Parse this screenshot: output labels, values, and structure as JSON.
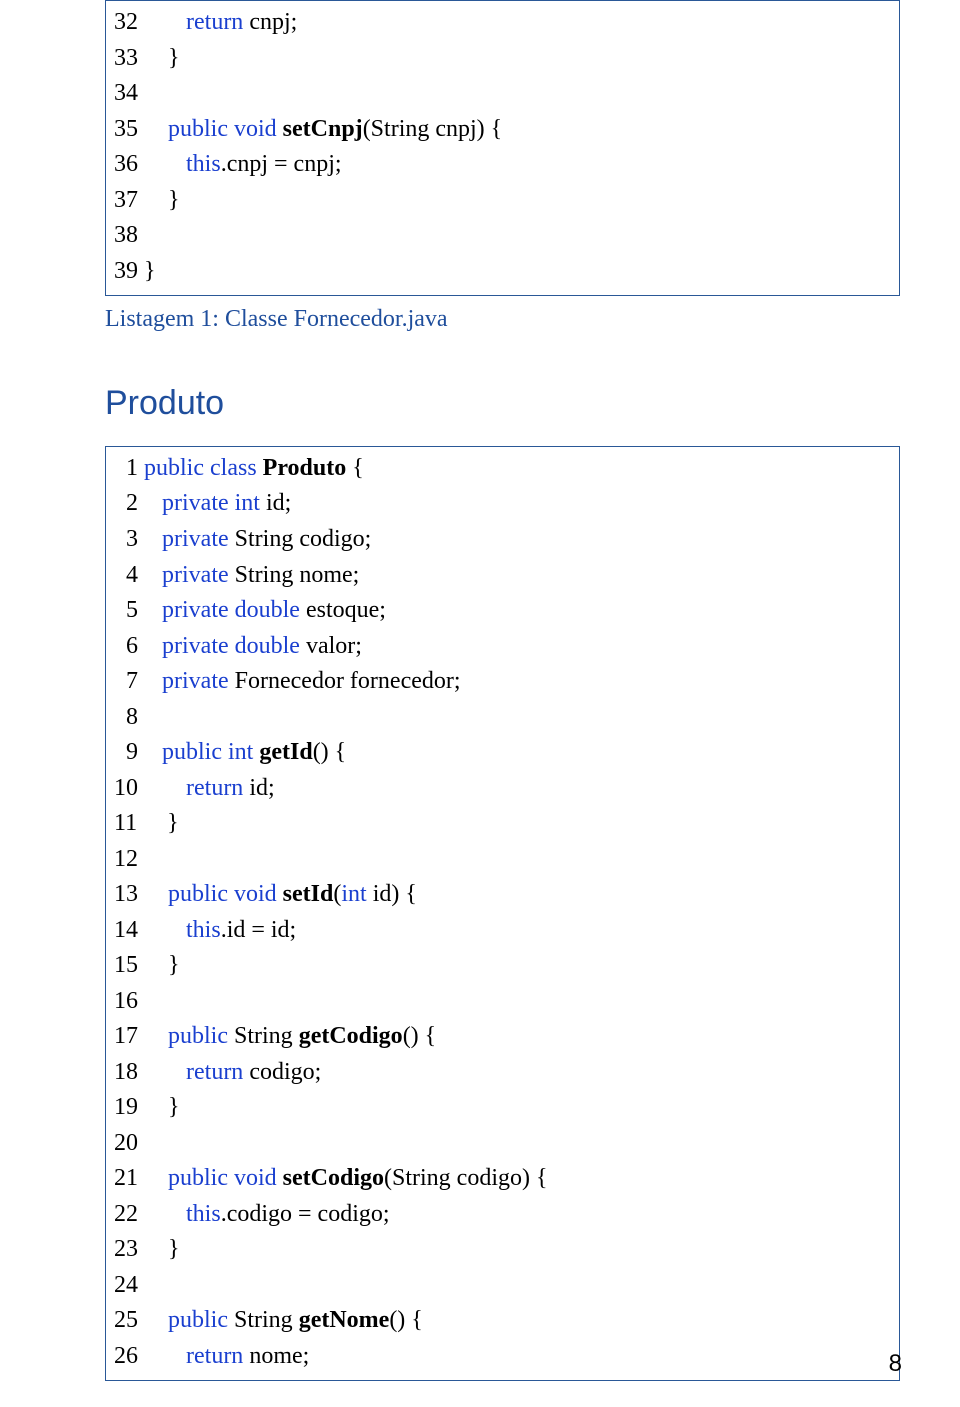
{
  "page_number": "8",
  "box1": {
    "lines": [
      [
        {
          "t": "32        ",
          "c": "ln"
        },
        {
          "t": "return",
          "c": "kw"
        },
        {
          "t": " cnpj;",
          "c": "txt"
        }
      ],
      [
        {
          "t": "33     }",
          "c": "ln"
        }
      ],
      [
        {
          "t": "34",
          "c": "ln"
        }
      ],
      [
        {
          "t": "35     ",
          "c": "ln"
        },
        {
          "t": "public",
          "c": "kw"
        },
        {
          "t": " ",
          "c": "txt"
        },
        {
          "t": "void",
          "c": "kw"
        },
        {
          "t": " ",
          "c": "txt"
        },
        {
          "t": "setCnpj",
          "c": "txt bold"
        },
        {
          "t": "(String cnpj) {",
          "c": "txt"
        }
      ],
      [
        {
          "t": "36        ",
          "c": "ln"
        },
        {
          "t": "this",
          "c": "kw"
        },
        {
          "t": ".cnpj = cnpj;",
          "c": "txt"
        }
      ],
      [
        {
          "t": "37     }",
          "c": "ln"
        }
      ],
      [
        {
          "t": "38",
          "c": "ln"
        }
      ],
      [
        {
          "t": "39 }",
          "c": "ln"
        }
      ]
    ]
  },
  "caption1": "Listagem 1: Classe Fornecedor.java",
  "heading2": "Produto",
  "box2": {
    "lines": [
      [
        {
          "t": "  1 ",
          "c": "ln"
        },
        {
          "t": "public",
          "c": "kw"
        },
        {
          "t": " ",
          "c": "txt"
        },
        {
          "t": "class",
          "c": "kw"
        },
        {
          "t": " ",
          "c": "txt"
        },
        {
          "t": "Produto",
          "c": "txt bold"
        },
        {
          "t": " {",
          "c": "txt"
        }
      ],
      [
        {
          "t": "  2    ",
          "c": "ln"
        },
        {
          "t": "private",
          "c": "kw"
        },
        {
          "t": " ",
          "c": "txt"
        },
        {
          "t": "int",
          "c": "kw"
        },
        {
          "t": " id;",
          "c": "txt"
        }
      ],
      [
        {
          "t": "  3    ",
          "c": "ln"
        },
        {
          "t": "private",
          "c": "kw"
        },
        {
          "t": " String codigo;",
          "c": "txt"
        }
      ],
      [
        {
          "t": "  4    ",
          "c": "ln"
        },
        {
          "t": "private",
          "c": "kw"
        },
        {
          "t": " String nome;",
          "c": "txt"
        }
      ],
      [
        {
          "t": "  5    ",
          "c": "ln"
        },
        {
          "t": "private",
          "c": "kw"
        },
        {
          "t": " ",
          "c": "txt"
        },
        {
          "t": "double",
          "c": "kw"
        },
        {
          "t": " estoque;",
          "c": "txt"
        }
      ],
      [
        {
          "t": "  6    ",
          "c": "ln"
        },
        {
          "t": "private",
          "c": "kw"
        },
        {
          "t": " ",
          "c": "txt"
        },
        {
          "t": "double",
          "c": "kw"
        },
        {
          "t": " valor;",
          "c": "txt"
        }
      ],
      [
        {
          "t": "  7    ",
          "c": "ln"
        },
        {
          "t": "private",
          "c": "kw"
        },
        {
          "t": " Fornecedor fornecedor;",
          "c": "txt"
        }
      ],
      [
        {
          "t": "  8",
          "c": "ln"
        }
      ],
      [
        {
          "t": "  9    ",
          "c": "ln"
        },
        {
          "t": "public",
          "c": "kw"
        },
        {
          "t": " ",
          "c": "txt"
        },
        {
          "t": "int",
          "c": "kw"
        },
        {
          "t": " ",
          "c": "txt"
        },
        {
          "t": "getId",
          "c": "txt bold"
        },
        {
          "t": "() {",
          "c": "txt"
        }
      ],
      [
        {
          "t": "10        ",
          "c": "ln"
        },
        {
          "t": "return",
          "c": "kw"
        },
        {
          "t": " id;",
          "c": "txt"
        }
      ],
      [
        {
          "t": "11     }",
          "c": "ln"
        }
      ],
      [
        {
          "t": "12",
          "c": "ln"
        }
      ],
      [
        {
          "t": "13     ",
          "c": "ln"
        },
        {
          "t": "public",
          "c": "kw"
        },
        {
          "t": " ",
          "c": "txt"
        },
        {
          "t": "void",
          "c": "kw"
        },
        {
          "t": " ",
          "c": "txt"
        },
        {
          "t": "setId",
          "c": "txt bold"
        },
        {
          "t": "(",
          "c": "txt"
        },
        {
          "t": "int",
          "c": "kw"
        },
        {
          "t": " id) {",
          "c": "txt"
        }
      ],
      [
        {
          "t": "14        ",
          "c": "ln"
        },
        {
          "t": "this",
          "c": "kw"
        },
        {
          "t": ".id = id;",
          "c": "txt"
        }
      ],
      [
        {
          "t": "15     }",
          "c": "ln"
        }
      ],
      [
        {
          "t": "16",
          "c": "ln"
        }
      ],
      [
        {
          "t": "17     ",
          "c": "ln"
        },
        {
          "t": "public",
          "c": "kw"
        },
        {
          "t": " String ",
          "c": "txt"
        },
        {
          "t": "getCodigo",
          "c": "txt bold"
        },
        {
          "t": "() {",
          "c": "txt"
        }
      ],
      [
        {
          "t": "18        ",
          "c": "ln"
        },
        {
          "t": "return",
          "c": "kw"
        },
        {
          "t": " codigo;",
          "c": "txt"
        }
      ],
      [
        {
          "t": "19     }",
          "c": "ln"
        }
      ],
      [
        {
          "t": "20",
          "c": "ln"
        }
      ],
      [
        {
          "t": "21     ",
          "c": "ln"
        },
        {
          "t": "public",
          "c": "kw"
        },
        {
          "t": " ",
          "c": "txt"
        },
        {
          "t": "void",
          "c": "kw"
        },
        {
          "t": " ",
          "c": "txt"
        },
        {
          "t": "setCodigo",
          "c": "txt bold"
        },
        {
          "t": "(String codigo) {",
          "c": "txt"
        }
      ],
      [
        {
          "t": "22        ",
          "c": "ln"
        },
        {
          "t": "this",
          "c": "kw"
        },
        {
          "t": ".codigo = codigo;",
          "c": "txt"
        }
      ],
      [
        {
          "t": "23     }",
          "c": "ln"
        }
      ],
      [
        {
          "t": "24",
          "c": "ln"
        }
      ],
      [
        {
          "t": "25     ",
          "c": "ln"
        },
        {
          "t": "public",
          "c": "kw"
        },
        {
          "t": " String ",
          "c": "txt"
        },
        {
          "t": "getNome",
          "c": "txt bold"
        },
        {
          "t": "() {",
          "c": "txt"
        }
      ],
      [
        {
          "t": "26        ",
          "c": "ln"
        },
        {
          "t": "return",
          "c": "kw"
        },
        {
          "t": " nome;",
          "c": "txt"
        }
      ]
    ]
  }
}
